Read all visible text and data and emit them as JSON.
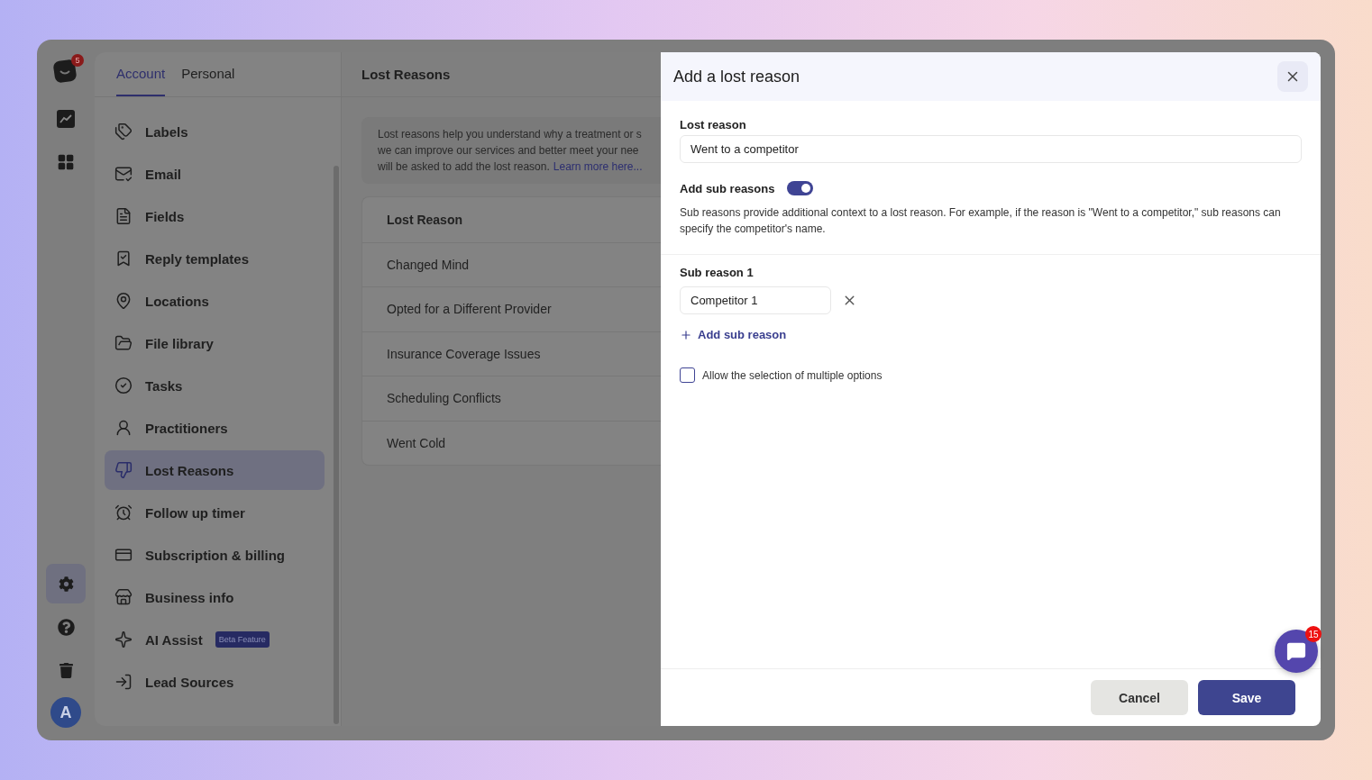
{
  "rail": {
    "notification_count": "5",
    "items": [
      {
        "kind": "analytics",
        "selected": false
      },
      {
        "kind": "apps",
        "selected": false
      },
      {
        "kind": "settings",
        "selected": true
      },
      {
        "kind": "help",
        "selected": false
      },
      {
        "kind": "trash",
        "selected": false
      }
    ],
    "avatar": "A"
  },
  "tabs": [
    {
      "label": "Account",
      "selected": true
    },
    {
      "label": "Personal",
      "selected": false
    }
  ],
  "sidebar": {
    "items": [
      {
        "kind": "labels",
        "label": "Labels",
        "selected": false
      },
      {
        "kind": "email",
        "label": "Email",
        "selected": false
      },
      {
        "kind": "fields",
        "label": "Fields",
        "selected": false
      },
      {
        "kind": "templates",
        "label": "Reply templates",
        "selected": false
      },
      {
        "kind": "locations",
        "label": "Locations",
        "selected": false
      },
      {
        "kind": "files",
        "label": "File library",
        "selected": false
      },
      {
        "kind": "tasks",
        "label": "Tasks",
        "selected": false
      },
      {
        "kind": "practitioners",
        "label": "Practitioners",
        "selected": false
      },
      {
        "kind": "lost",
        "label": "Lost Reasons",
        "selected": true
      },
      {
        "kind": "timer",
        "label": "Follow up timer",
        "selected": false
      },
      {
        "kind": "billing",
        "label": "Subscription & billing",
        "selected": false
      },
      {
        "kind": "business",
        "label": "Business info",
        "selected": false
      },
      {
        "kind": "ai",
        "label": "AI Assist",
        "badge": "Beta Feature",
        "selected": false
      },
      {
        "kind": "sources",
        "label": "Lead Sources",
        "selected": false
      }
    ]
  },
  "main": {
    "title": "Lost Reasons",
    "info_lines": [
      "Lost reasons help you understand why a treatment or s",
      "we can improve our services and better meet your nee",
      "will be asked to add the lost reason."
    ],
    "info_link": "Learn more here...",
    "table": {
      "columns": [
        "Lost Reason"
      ],
      "rows": [
        "Changed Mind",
        "Opted for a Different Provider",
        "Insurance Coverage Issues",
        "Scheduling Conflicts",
        "Went Cold"
      ]
    }
  },
  "modal": {
    "title": "Add a lost reason",
    "lost_reason_label": "Lost reason",
    "lost_reason_value": "Went to a competitor",
    "sub_toggle_label": "Add sub reasons",
    "sub_toggle_on": true,
    "sub_help": "Sub reasons provide additional context to a lost reason. For example, if the reason is \"Went to a competitor,\" sub reasons can specify the competitor's name.",
    "sub_reasons": [
      {
        "label": "Sub reason 1",
        "value": "Competitor 1"
      }
    ],
    "add_sub_reason": "Add sub reason",
    "multiple_label": "Allow the selection of multiple options",
    "multiple_checked": false,
    "buttons": [
      {
        "kind": "secondary",
        "label": "Cancel"
      },
      {
        "kind": "primary",
        "label": "Save"
      }
    ]
  },
  "chat": {
    "badge": "15"
  }
}
